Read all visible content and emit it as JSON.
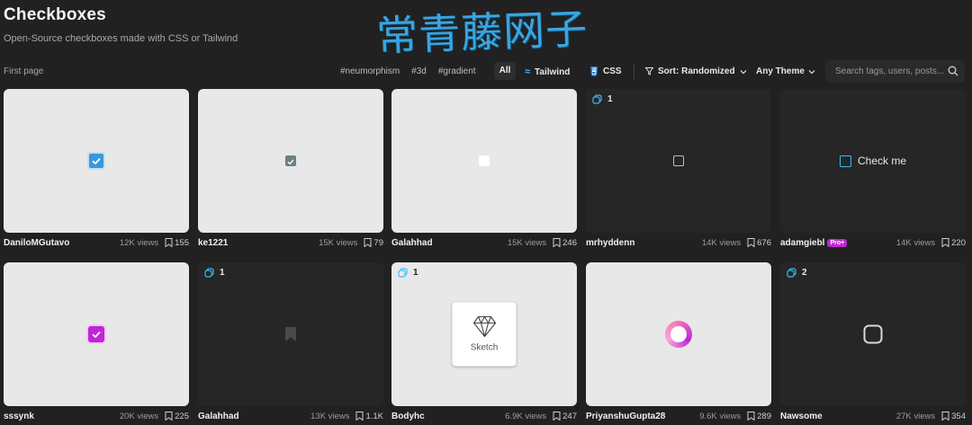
{
  "header": {
    "title": "Checkboxes",
    "subtitle": "Open-Source checkboxes made with CSS or Tailwind"
  },
  "watermark": "常青藤网子",
  "toolbar": {
    "first_page": "First page",
    "tags": [
      "#neumorphism",
      "#3d",
      "#gradient"
    ],
    "filters": {
      "all": "All",
      "tailwind": "Tailwind",
      "css": "CSS"
    },
    "sort_label": "Sort: Randomized",
    "theme_label": "Any Theme",
    "search_placeholder": "Search tags, users, posts..."
  },
  "colors": {
    "accent_blue": "#38bdf8",
    "pro_purple": "#c026d3",
    "background": "#212121"
  },
  "cards": [
    {
      "author": "DaniloMGutavo",
      "views": "12K views",
      "bookmarks": "155",
      "variants": "",
      "preview": "blue-checked-checkbox"
    },
    {
      "author": "ke1221",
      "views": "15K views",
      "bookmarks": "79",
      "variants": "",
      "preview": "gray-checked-checkbox"
    },
    {
      "author": "Galahhad",
      "views": "15K views",
      "bookmarks": "246",
      "variants": "",
      "preview": "white-checkbox"
    },
    {
      "author": "mrhyddenn",
      "views": "14K views",
      "bookmarks": "676",
      "variants": "1",
      "preview": "outline-checkbox"
    },
    {
      "author": "adamgiebl",
      "badge": "Pro+",
      "views": "14K views",
      "bookmarks": "220",
      "variants": "",
      "preview": "check-me-checkbox",
      "preview_text": "Check me"
    },
    {
      "author": "sssynk",
      "views": "20K views",
      "bookmarks": "225",
      "variants": "",
      "preview": "purple-checked-checkbox"
    },
    {
      "author": "Galahhad",
      "views": "13K views",
      "bookmarks": "1.1K",
      "variants": "1",
      "preview": "bookmark-checkbox"
    },
    {
      "author": "Bodyhc",
      "views": "6.9K views",
      "bookmarks": "247",
      "variants": "1",
      "preview": "sketch-checkbox",
      "preview_text": "Sketch"
    },
    {
      "author": "PriyanshuGupta28",
      "views": "9.6K views",
      "bookmarks": "289",
      "variants": "",
      "preview": "gradient-ring-checkbox"
    },
    {
      "author": "Nawsome",
      "views": "27K views",
      "bookmarks": "354",
      "variants": "2",
      "preview": "rounded-checkbox"
    }
  ]
}
